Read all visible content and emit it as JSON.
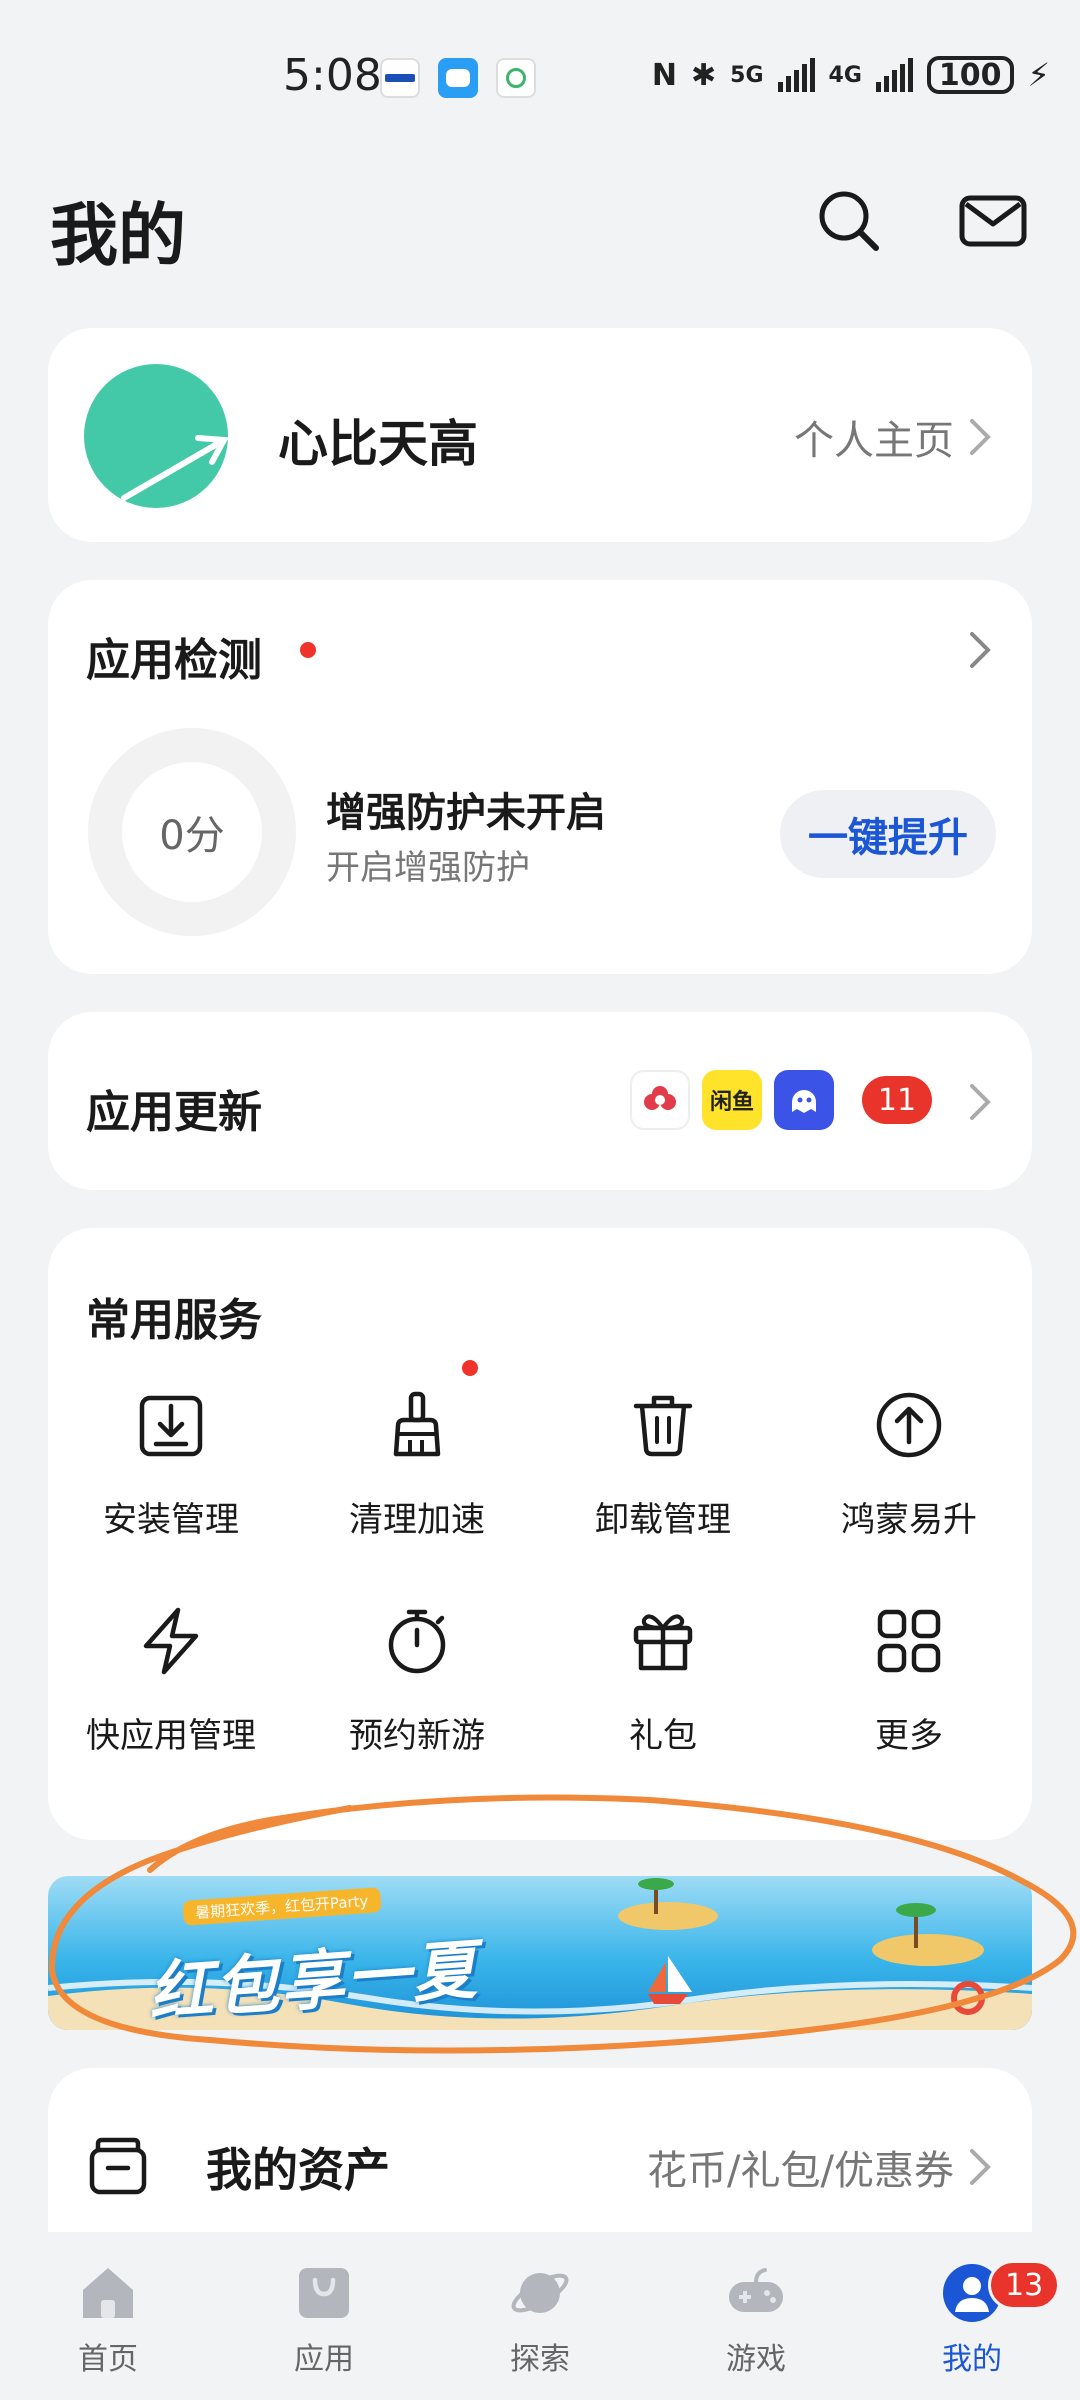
{
  "status_bar": {
    "time": "5:08",
    "network_5g": "5G",
    "network_4g": "4G",
    "battery": "100"
  },
  "header": {
    "title": "我的",
    "search_icon": "search-icon",
    "mail_icon": "mail-icon"
  },
  "profile": {
    "username": "心比天高",
    "homepage_link": "个人主页"
  },
  "app_check": {
    "title": "应用检测",
    "score": "0分",
    "protection_title": "增强防护未开启",
    "protection_sub": "开启增强防护",
    "boost_button": "一键提升"
  },
  "app_update": {
    "title": "应用更新",
    "app_icons": [
      "app-icon-flower",
      "app-icon-xianyu",
      "app-icon-qq"
    ],
    "xianyu_text": "闲鱼",
    "count": "11"
  },
  "services": {
    "title": "常用服务",
    "items": [
      {
        "label": "安装管理",
        "icon": "install-icon"
      },
      {
        "label": "清理加速",
        "icon": "broom-icon"
      },
      {
        "label": "卸载管理",
        "icon": "trash-icon"
      },
      {
        "label": "鸿蒙易升",
        "icon": "upgrade-icon"
      },
      {
        "label": "快应用管理",
        "icon": "lightning-icon"
      },
      {
        "label": "预约新游",
        "icon": "stopwatch-icon"
      },
      {
        "label": "礼包",
        "icon": "gift-icon"
      },
      {
        "label": "更多",
        "icon": "grid-icon"
      }
    ]
  },
  "banner": {
    "ribbon": "暑期狂欢季，红包开Party",
    "title": "红包享一夏"
  },
  "assets": {
    "title": "我的资产",
    "link": "花币/礼包/优惠券"
  },
  "bottom_nav": {
    "items": [
      {
        "label": "首页",
        "icon": "home-icon"
      },
      {
        "label": "应用",
        "icon": "bag-icon"
      },
      {
        "label": "探索",
        "icon": "planet-icon"
      },
      {
        "label": "游戏",
        "icon": "gamepad-icon"
      },
      {
        "label": "我的",
        "icon": "user-icon"
      }
    ],
    "active_index": 4,
    "badge": "13"
  },
  "colors": {
    "accent": "#1a56d6",
    "badge": "#e8342b",
    "avatar": "#43c9a7",
    "annotation": "#f0893a"
  }
}
